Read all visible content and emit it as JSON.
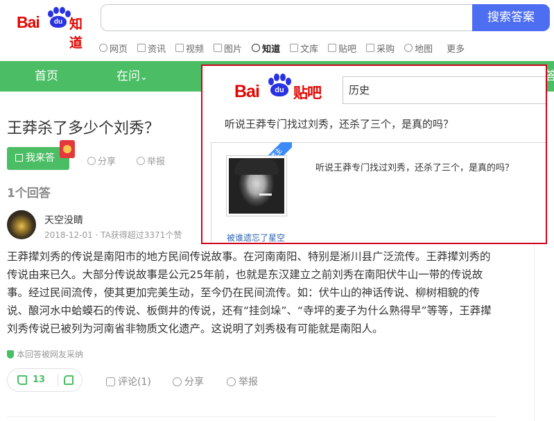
{
  "header": {
    "logo": {
      "bai": "Bai",
      "du": "du",
      "suffix": "知道"
    },
    "search_button": "搜索答案"
  },
  "nav": [
    {
      "label": "网页",
      "icon": "search-icon"
    },
    {
      "label": "资讯",
      "icon": "news-icon"
    },
    {
      "label": "视频",
      "icon": "video-icon"
    },
    {
      "label": "图片",
      "icon": "image-icon"
    },
    {
      "label": "知道",
      "icon": "question-icon",
      "active": true
    },
    {
      "label": "文库",
      "icon": "doc-icon"
    },
    {
      "label": "贴吧",
      "icon": "tieba-icon"
    },
    {
      "label": "采购",
      "icon": "shop-icon"
    },
    {
      "label": "地图",
      "icon": "map-icon"
    },
    {
      "label": "更多",
      "icon": ""
    }
  ],
  "green_bar": {
    "home": "首页",
    "asking": "在问",
    "asking_chevron": "⌄",
    "edge_text": "答"
  },
  "question": {
    "title": "王莽杀了多少个刘秀？",
    "answer_button": "我来答",
    "share": "分享",
    "report": "举报"
  },
  "answers_count": "1个回答",
  "answer": {
    "user_name": "天空没睛",
    "meta": "2018-12-01 · TA获得超过3371个赞",
    "body": "王莽撵刘秀的传说是南阳市的地方民间传说故事。在河南南阳、特别是淅川县广泛流传。王莽撵刘秀的传说由来已久。大部分传说故事是公元25年前，也就是东汉建立之前刘秀在南阳伏牛山一带的传说故事。经过民间流传，使其更加完美生动，至今仍在民间流传。如：伏牛山的神话传说、柳树相貌的传说、酿河水中蛤蟆石的传说、板倒井的传说，还有“挂剑垛”、“寺坪的麦子为什么熟得早”等等，王莽撵刘秀传说已被列为河南省非物质文化遗产。这说明了刘秀极有可能就是南阳人。",
    "adopted": "本回答被网友采纳",
    "likes": "13",
    "comment": "评论(1)",
    "share": "分享",
    "report": "举报"
  },
  "popup": {
    "logo": {
      "bai": "Bai",
      "du": "du",
      "suffix": "贴吧"
    },
    "input_value": "历史",
    "question": "听说王莽专门找过刘秀，还杀了三个，是真的吗？",
    "ribbon": "楼主",
    "post_text": "听说王莽专门找过刘秀，还杀了三个，是真的吗？",
    "user": "被谁遗忘了星空"
  }
}
